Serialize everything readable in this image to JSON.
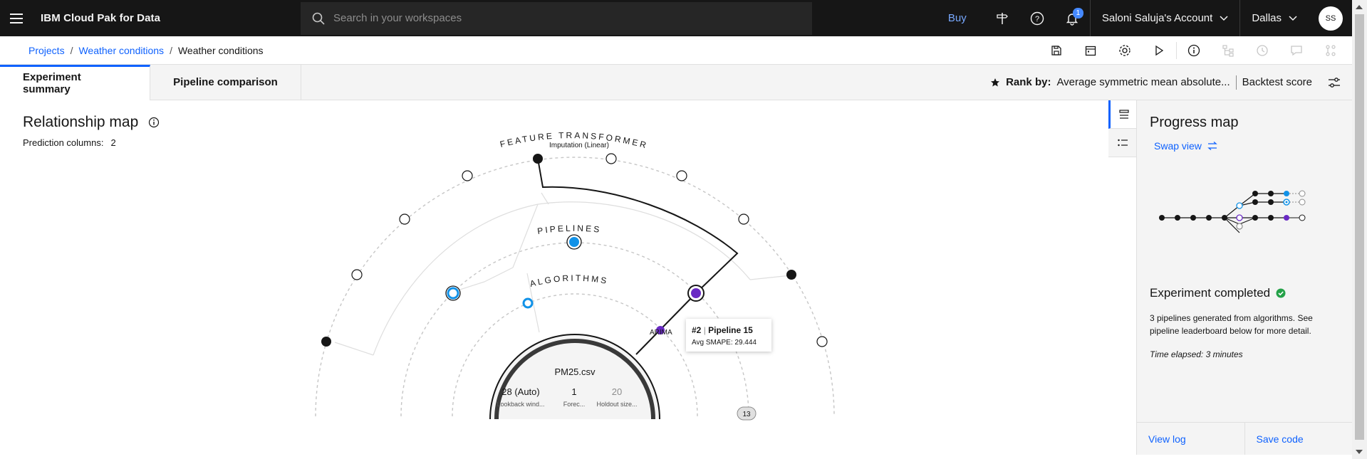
{
  "header": {
    "brand": "IBM Cloud Pak for Data",
    "search_placeholder": "Search in your workspaces",
    "buy_label": "Buy",
    "notification_count": "1",
    "account_label": "Saloni Saluja's Account",
    "region_label": "Dallas",
    "avatar_initials": "SS"
  },
  "breadcrumb": {
    "items": [
      "Projects",
      "Weather conditions",
      "Weather conditions"
    ]
  },
  "tabs": {
    "summary": "Experiment summary",
    "comparison": "Pipeline comparison"
  },
  "rank": {
    "label": "Rank by:",
    "metric": "Average symmetric mean absolute...",
    "score": "Backtest score"
  },
  "relationship_map": {
    "title": "Relationship map",
    "prediction_label": "Prediction columns:",
    "prediction_value": "2",
    "ring_feature": "FEATURE TRANSFORMERS",
    "ring_feature_sub": "Imputation (Linear)",
    "ring_pipelines": "PIPELINES",
    "ring_algorithms": "ALGORITHMS",
    "algo_label": "ARIMA",
    "tooltip_rank": "#2",
    "tooltip_pipeline": "Pipeline 15",
    "tooltip_metric": "Avg SMAPE: 29.444",
    "dataset": "PM25.csv",
    "stats": [
      {
        "value": "28 (Auto)",
        "label": "Lookback wind..."
      },
      {
        "value": "1",
        "label": "Forec..."
      },
      {
        "value": "20",
        "label": "Holdout size..."
      }
    ],
    "count_badge": "13",
    "accent_blue": "#1192e8",
    "accent_purple": "#6929c4"
  },
  "progress": {
    "title": "Progress map",
    "swap_label": "Swap view",
    "status": "Experiment completed",
    "description": "3 pipelines generated from algorithms. See pipeline leaderboard below for more detail.",
    "elapsed": "Time elapsed: 3 minutes",
    "view_log": "View log",
    "save_code": "Save code",
    "success_color": "#24a148"
  }
}
